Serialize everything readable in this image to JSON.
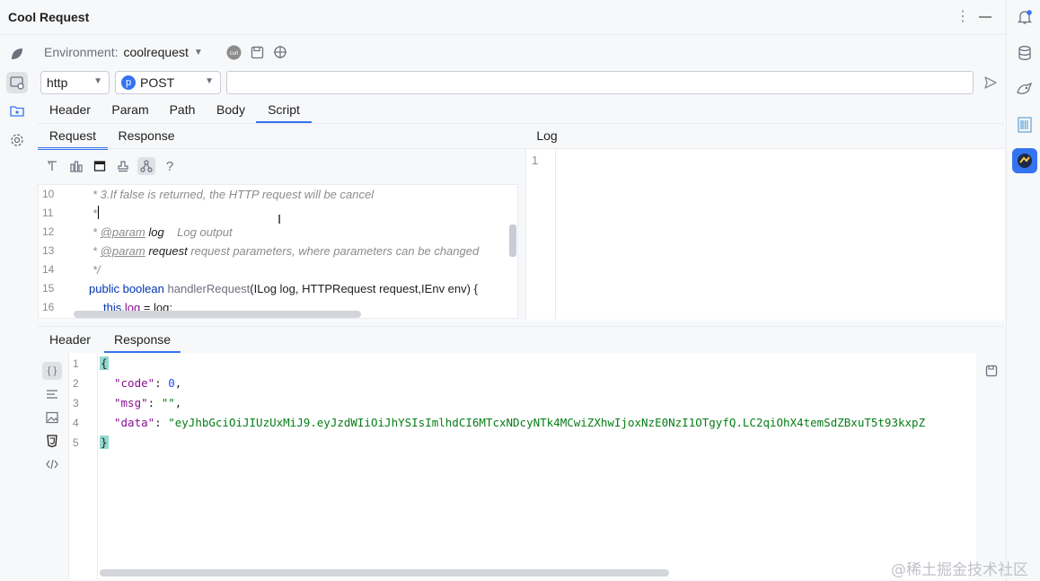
{
  "app": {
    "title": "Cool Request"
  },
  "environment": {
    "label": "Environment:",
    "value": "coolrequest"
  },
  "request": {
    "protocol": "http",
    "method_badge": "p",
    "method": "POST",
    "url_value": "",
    "url_placeholder": ""
  },
  "request_tabs": [
    "Header",
    "Param",
    "Path",
    "Body",
    "Script"
  ],
  "script_tabs": [
    "Request",
    "Response"
  ],
  "log": {
    "title": "Log",
    "lines": [
      "1"
    ]
  },
  "script_editor": {
    "lines": [
      {
        "num": "10",
        "text": "* 3.If false is returned, the HTTP request will be cancel"
      },
      {
        "num": "11",
        "text": "*"
      },
      {
        "num": "12",
        "tag": "@param",
        "name": "log",
        "desc": "Log output"
      },
      {
        "num": "13",
        "tag": "@param",
        "name": "request",
        "desc": "request parameters, where parameters can be changed"
      },
      {
        "num": "14",
        "text": "*/"
      },
      {
        "num": "15",
        "kw1": "public",
        "kw2": "boolean",
        "method": "handlerRequest",
        "params": "(ILog log, HTTPRequest request,IEnv env) {"
      },
      {
        "num": "16",
        "this": "this",
        "field": "log",
        "rest": " = log;"
      }
    ]
  },
  "response_tabs": [
    "Header",
    "Response"
  ],
  "response_body": {
    "lines": [
      {
        "num": "1",
        "text": "{"
      },
      {
        "num": "2",
        "key": "\"code\"",
        "value": "0"
      },
      {
        "num": "3",
        "key": "\"msg\"",
        "value": "\"\""
      },
      {
        "num": "4",
        "key": "\"data\"",
        "value": "\"eyJhbGciOiJIUzUxMiJ9.eyJzdWIiOiJhYSIsImlhdCI6MTcxNDcyNTk4MCwiZXhwIjoxNzE0NzI1OTgyfQ.LC2qiOhX4temSdZBxuT5t93kxpZ"
      },
      {
        "num": "5",
        "text": "}"
      }
    ]
  },
  "watermark": "@稀土掘金技术社区",
  "colors": {
    "accent": "#3574f0",
    "background": "#f7f8fa"
  }
}
